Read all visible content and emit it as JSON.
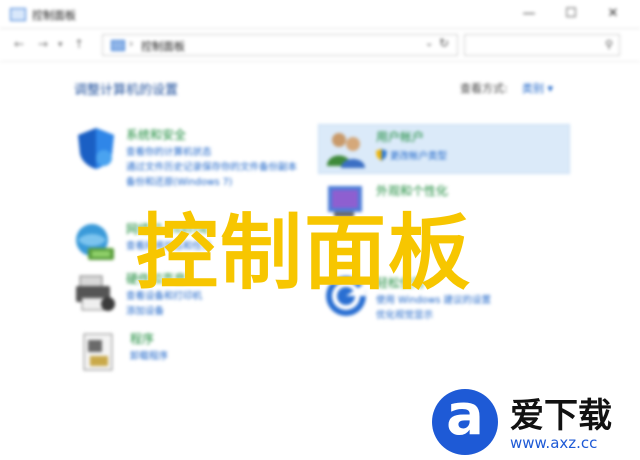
{
  "window": {
    "title": "控制面板",
    "controls": {
      "minimize": "—",
      "maximize": "☐",
      "close": "✕"
    }
  },
  "address_bar": {
    "back": "←",
    "forward": "→",
    "recent": "▾",
    "up": "↑",
    "separator": "›",
    "path": "控制面板",
    "path_dropdown": "⌄",
    "refresh": "↻",
    "search_icon": "⚲"
  },
  "main": {
    "heading": "调整计算机的设置",
    "view_by_label": "查看方式:",
    "view_by_value": "类别 ▾"
  },
  "categories": [
    {
      "title": "系统和安全",
      "links": [
        "查看你的计算机状态",
        "通过文件历史记录保存你的文件备份副本",
        "备份和还原(Windows 7)"
      ],
      "icon": "shield-icon"
    },
    {
      "title": "网络和 Internet",
      "links": [
        "查看网络状态和任务"
      ],
      "icon": "network-icon"
    },
    {
      "title": "硬件和声音",
      "links": [
        "查看设备和打印机",
        "添加设备"
      ],
      "icon": "printer-icon"
    },
    {
      "title": "程序",
      "links": [
        "卸载程序"
      ],
      "icon": "programs-icon"
    },
    {
      "title": "用户帐户",
      "links": [
        "更改帐户类型"
      ],
      "icon": "users-icon"
    },
    {
      "title": "外观和个性化",
      "links": [],
      "icon": "appearance-icon"
    },
    {
      "title": "轻松使用",
      "links": [
        "使用 Windows 建议的设置",
        "优化视觉显示"
      ],
      "icon": "ease-of-access-icon"
    }
  ],
  "overlay": {
    "title": "控制面板"
  },
  "watermark": {
    "logo_letter": "a",
    "name": "爱下载",
    "url": "www.axz.cc"
  },
  "colors": {
    "overlay_title": "#f7c600",
    "link": "#1a63c8",
    "category_title": "#1a8a3a",
    "watermark_blue": "#1e5ad6"
  }
}
